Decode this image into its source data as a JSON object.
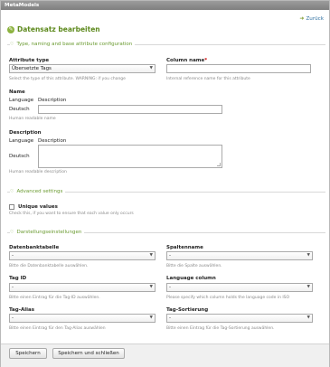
{
  "window": {
    "title": "MetaModels"
  },
  "back_link": {
    "label": "Zurück"
  },
  "page": {
    "title": "Datensatz bearbeiten"
  },
  "sections": {
    "type_naming": "Type, naming and base attribute configuration",
    "advanced": "Advanced settings",
    "display": "Darstellungseinstellungen"
  },
  "attribute_type": {
    "label": "Attribute type",
    "value": "Übersetzte Tags",
    "hint": "Select the type of this attribute. WARNING:  if you change"
  },
  "column_name": {
    "label": "Column name",
    "required_mark": "*",
    "value": "",
    "hint": "Internal reference name for this attribute"
  },
  "name": {
    "label": "Name",
    "col_language": "Language",
    "col_description": "Description",
    "row_language": "Deutsch",
    "value": "",
    "hint": "Human readable name"
  },
  "description": {
    "label": "Description",
    "col_language": "Language",
    "col_description": "Description",
    "row_language": "Deutsch",
    "value": "",
    "hint": "Human readable description"
  },
  "unique": {
    "label": "Unique values",
    "checked": false,
    "hint": "Check this, if you want to ensure that each value only occurs"
  },
  "datenbanktabelle": {
    "label": "Datenbanktabelle",
    "value": "-",
    "hint": "Bitte die Datenbanktabelle auswählen."
  },
  "spaltenname": {
    "label": "Spaltenname",
    "value": "-",
    "hint": "Bitte die Spalte auswählen."
  },
  "tag_id": {
    "label": "Tag ID",
    "value": "-",
    "hint": "Bitte einen Eintrag für die Tag-ID auswählen."
  },
  "language_column": {
    "label": "Language column",
    "value": "-",
    "hint": "Please specify which column holds the language code in ISO"
  },
  "tag_alias": {
    "label": "Tag-Alias",
    "value": "-",
    "hint": "Bitte einen Eintrag für den Tag-Alias auswählen"
  },
  "tag_sortierung": {
    "label": "Tag-Sortierung",
    "value": "-",
    "hint": "Bitte einen Eintrag für die Tag-Sortierung auswählen."
  },
  "buttons": {
    "save": "Speichern",
    "save_close": "Speichern und schließen"
  },
  "icons": {
    "back": "back-arrow-icon",
    "edit": "edit-icon",
    "toggle": "heart-icon",
    "dropdown": "chevron-down-icon"
  },
  "colors": {
    "accent": "#5e8a1e",
    "link": "#2e6fa0",
    "titlebar": "#8c8c8c"
  }
}
